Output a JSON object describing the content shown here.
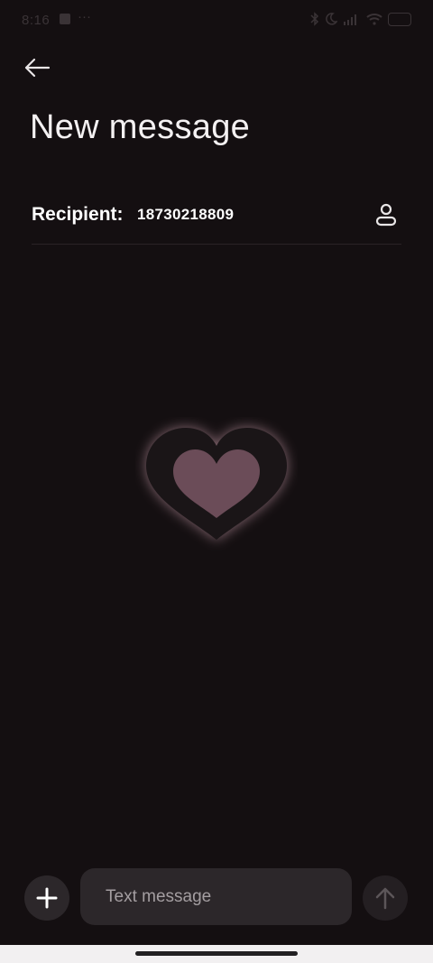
{
  "status_bar": {
    "time": "8:16",
    "more": "···"
  },
  "header": {
    "title": "New message"
  },
  "recipient": {
    "label": "Recipient:",
    "value": "18730218809"
  },
  "composer": {
    "placeholder": "Text message"
  },
  "icons": {
    "back": "arrow-left-icon",
    "contact": "person-icon",
    "add": "plus-icon",
    "send": "arrow-up-icon",
    "empty_state": "heart-icon"
  },
  "colors": {
    "background": "#140f11",
    "surface": "#2c272a",
    "heart_fill": "#6b4c58",
    "heart_glow": "#e7b5c4"
  }
}
